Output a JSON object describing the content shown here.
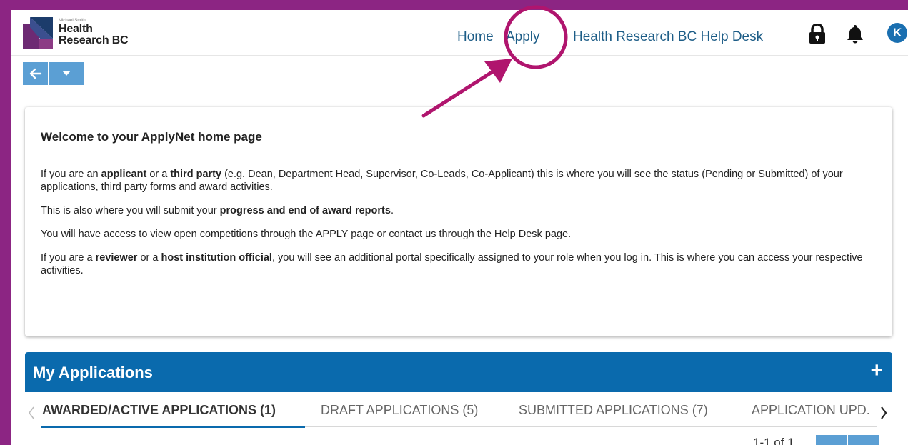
{
  "brand": {
    "small_text": "Michael Smith",
    "line1": "Health",
    "line2": "Research BC",
    "color_primary": "#6d2a73",
    "color_secondary": "#1c3c6b"
  },
  "nav": {
    "home": "Home",
    "apply": "Apply",
    "help_desk": "Health Research BC Help Desk"
  },
  "header_icons": {
    "lock": "lock-icon",
    "bell": "bell-icon",
    "avatar_initial": "K"
  },
  "toolbar": {
    "back": "arrow-left-icon",
    "menu": "caret-down-icon"
  },
  "welcome": {
    "title": "Welcome to your ApplyNet home page",
    "p1_a": "If you are an ",
    "p1_b": "applicant",
    "p1_c": " or a ",
    "p1_d": "third party",
    "p1_e": " (e.g. Dean, Department Head, Supervisor, Co-Leads, Co-Applicant) this is where you will see the status (Pending or Submitted) of your applications, third party forms and award activities.",
    "p2_a": "This is also where you will submit your ",
    "p2_b": "progress and end of award reports",
    "p2_c": ".",
    "p3": "You will have access to view open competitions through the APPLY page or contact us through the Help Desk page.",
    "p4_a": "If you are a ",
    "p4_b": "reviewer",
    "p4_c": " or a ",
    "p4_d": "host institution official",
    "p4_e": ", you will see an additional portal specifically assigned to your role when you log in. This is where you can access your respective activities."
  },
  "applications": {
    "title": "My Applications",
    "add": "+",
    "tabs": [
      "AWARDED/ACTIVE APPLICATIONS (1)",
      "DRAFT APPLICATIONS (5)",
      "SUBMITTED APPLICATIONS (7)",
      "APPLICATION UPD."
    ],
    "pager": "1-1 of 1"
  },
  "colors": {
    "accent": "#0a6aad",
    "background": "#8c2583",
    "annotation": "#b0156e"
  }
}
